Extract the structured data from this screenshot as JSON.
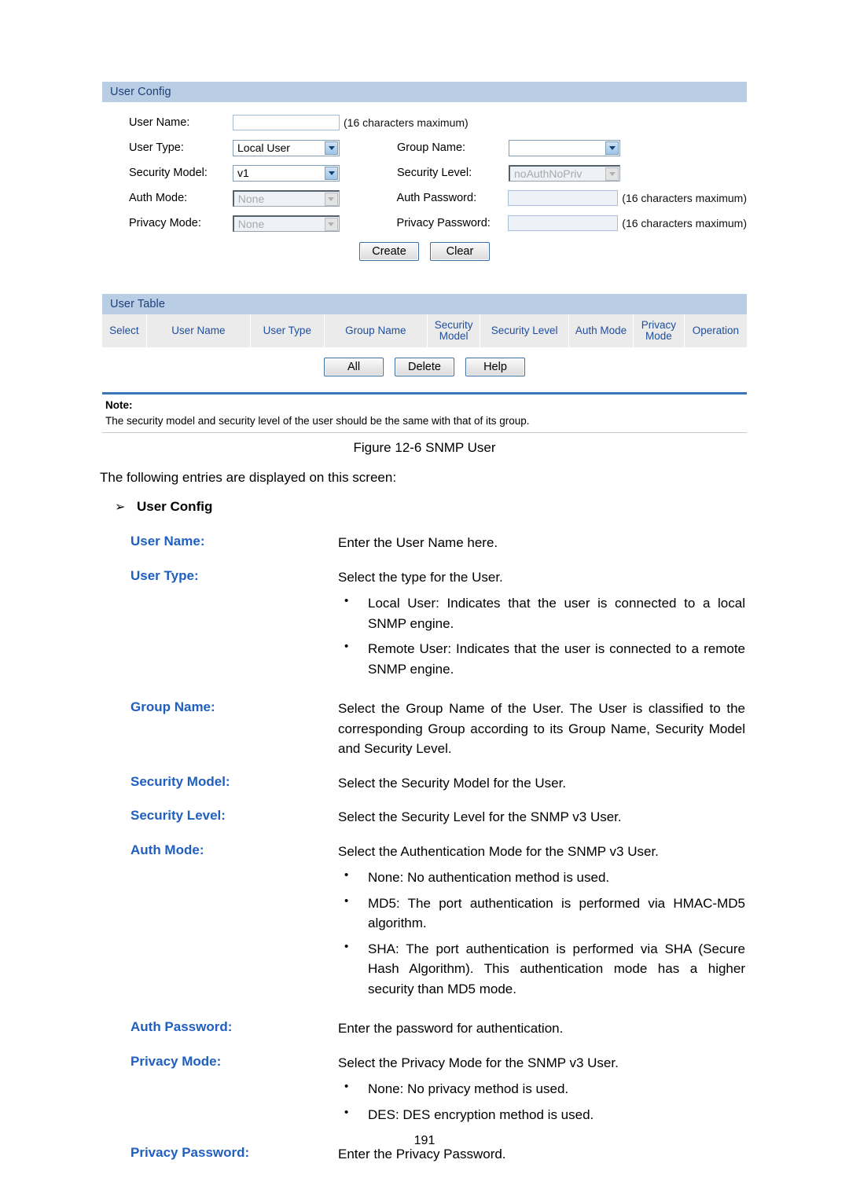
{
  "figure": {
    "user_config": {
      "panel_title": "User Config",
      "fields": {
        "user_name_label": "User Name:",
        "user_name_value": "",
        "user_name_hint": "(16 characters maximum)",
        "user_type_label": "User Type:",
        "user_type_value": "Local User",
        "group_name_label": "Group Name:",
        "group_name_value": "",
        "security_model_label": "Security Model:",
        "security_model_value": "v1",
        "security_level_label": "Security Level:",
        "security_level_value": "noAuthNoPriv",
        "auth_mode_label": "Auth Mode:",
        "auth_mode_value": "None",
        "auth_password_label": "Auth Password:",
        "auth_password_value": "",
        "auth_password_hint": "(16 characters maximum)",
        "privacy_mode_label": "Privacy Mode:",
        "privacy_mode_value": "None",
        "privacy_password_label": "Privacy Password:",
        "privacy_password_value": "",
        "privacy_password_hint": "(16 characters maximum)"
      },
      "buttons": {
        "create": "Create",
        "clear": "Clear"
      }
    },
    "user_table": {
      "panel_title": "User Table",
      "columns": [
        "Select",
        "User Name",
        "User Type",
        "Group Name",
        "Security Model",
        "Security Level",
        "Auth Mode",
        "Privacy Mode",
        "Operation"
      ],
      "rows": [],
      "buttons": {
        "all": "All",
        "delete": "Delete",
        "help": "Help"
      }
    },
    "note": {
      "title": "Note:",
      "text": "The security model and security level of the user should be the same with that of its group."
    },
    "colors": {
      "panel_header_bg": "#b9cde5",
      "panel_header_text": "#1f3f7a",
      "table_header_bg": "#ebebeb",
      "table_header_text": "#1f4e9c",
      "note_separator": "#3877b5",
      "term_blue": "#1f5fc0"
    }
  },
  "document": {
    "caption": "Figure 12-6 SNMP User",
    "intro": "The following entries are displayed on this screen:",
    "section_heading": "User Config",
    "section_arrow": "➢",
    "entries": [
      {
        "term": "User Name:",
        "def": "Enter the User Name here.",
        "bullets": []
      },
      {
        "term": "User Type:",
        "def": "Select the type for the User.",
        "bullets": [
          "Local User: Indicates that the user is connected to a local SNMP engine.",
          "Remote User: Indicates that the user is connected to a remote SNMP engine."
        ]
      },
      {
        "term": "Group Name:",
        "def": "Select the Group Name of the User. The User is classified to the corresponding Group according to its Group Name, Security Model and Security Level.",
        "bullets": []
      },
      {
        "term": "Security Model:",
        "def": "Select the Security Model for the User.",
        "bullets": []
      },
      {
        "term": "Security Level:",
        "def": "Select the Security Level for the SNMP v3 User.",
        "bullets": []
      },
      {
        "term": "Auth Mode:",
        "def": "Select the Authentication Mode for the SNMP v3 User.",
        "bullets": [
          "None: No authentication method is used.",
          "MD5: The port authentication is performed via HMAC-MD5 algorithm.",
          "SHA: The port authentication is performed via SHA (Secure Hash Algorithm). This authentication mode has a higher security than MD5 mode."
        ]
      },
      {
        "term": "Auth Password:",
        "def": "Enter the password for authentication.",
        "bullets": []
      },
      {
        "term": "Privacy Mode:",
        "def": "Select the Privacy Mode for the SNMP v3 User.",
        "bullets": [
          "None: No privacy method is used.",
          "DES: DES encryption method is used."
        ]
      },
      {
        "term": "Privacy Password:",
        "def": "Enter the Privacy Password.",
        "bullets": []
      }
    ],
    "page_number": "191"
  }
}
